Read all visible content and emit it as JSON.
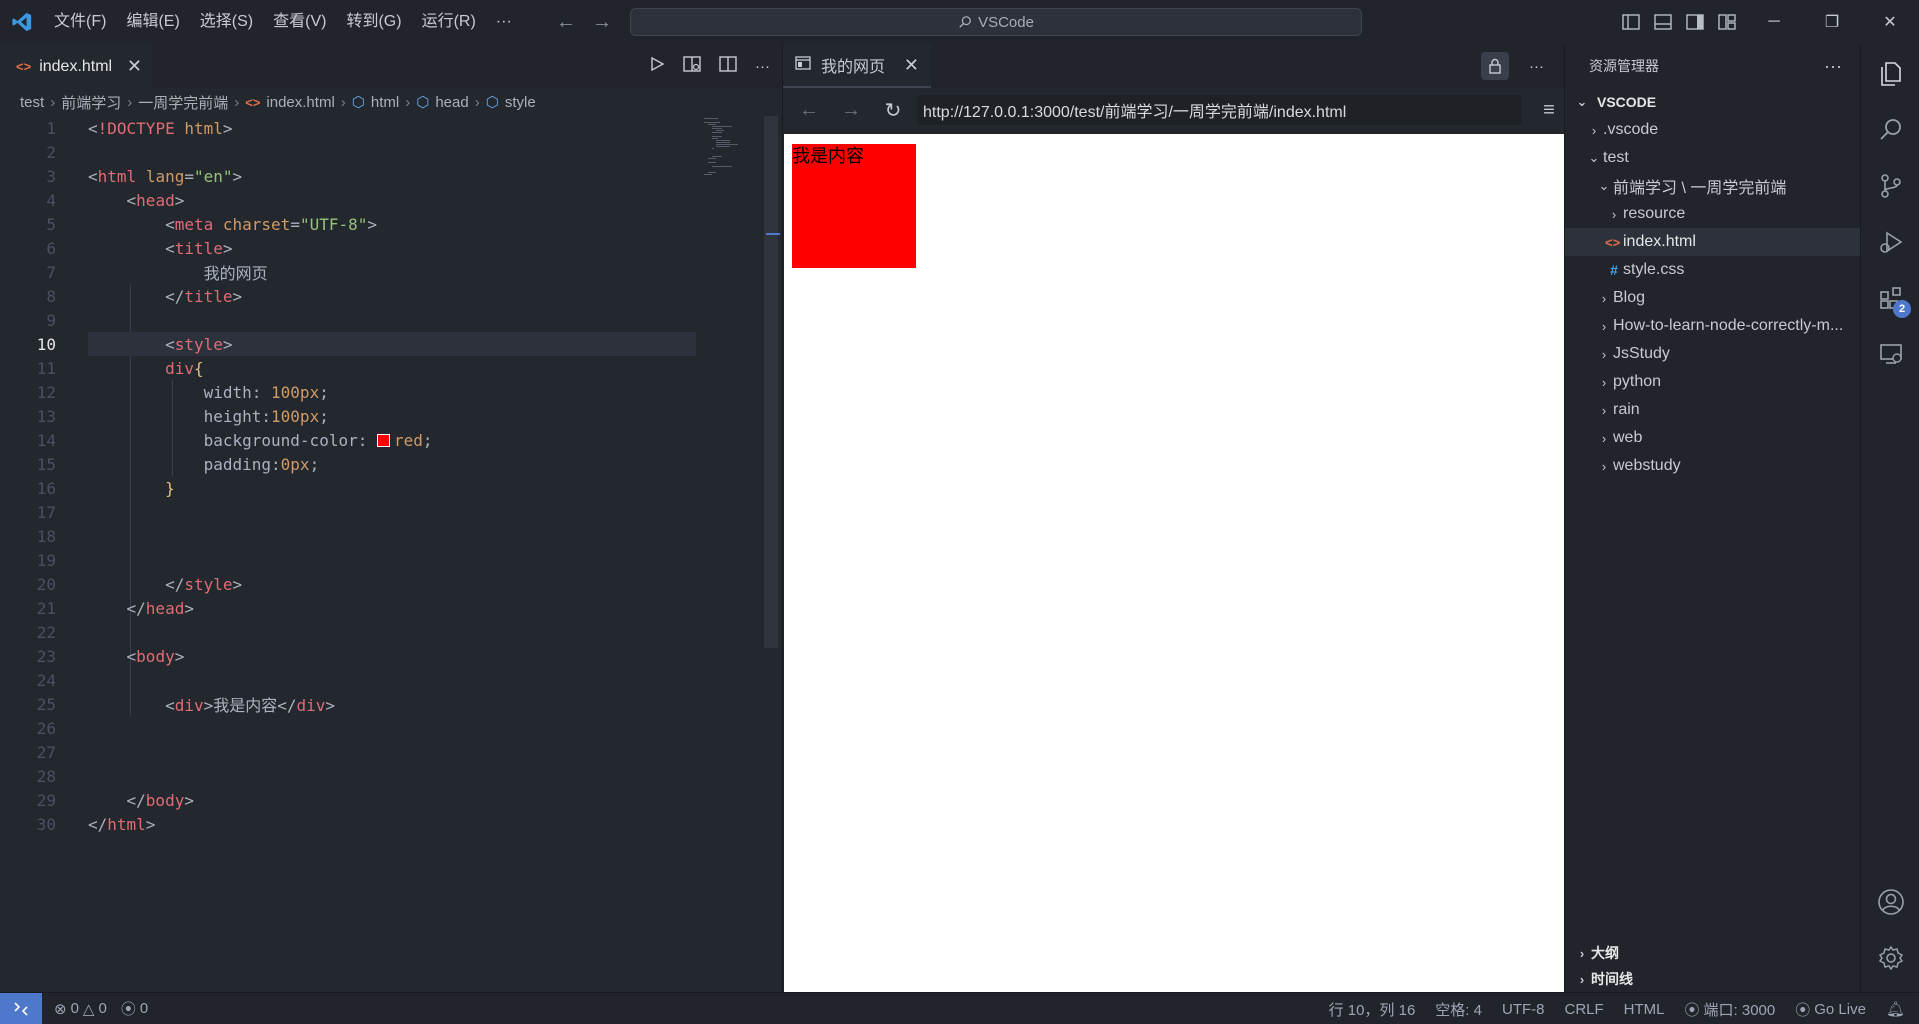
{
  "titlebar": {
    "menu": [
      "文件(F)",
      "编辑(E)",
      "选择(S)",
      "查看(V)",
      "转到(G)",
      "运行(R)",
      "···"
    ],
    "search_text": "VSCode"
  },
  "editor": {
    "tab_label": "index.html",
    "breadcrumbs": [
      "test",
      "前端学习",
      "一周学完前端",
      "index.html",
      "html",
      "head",
      "style"
    ],
    "current_line": 10
  },
  "preview": {
    "tab_label": "我的网页",
    "url": "http://127.0.0.1:3000/test/前端学习/一周学完前端/index.html",
    "page_div_text": "我是内容",
    "div_background": "#ff0000"
  },
  "explorer": {
    "header": "资源管理器",
    "root": "VSCODE",
    "tree": [
      {
        "label": ".vscode",
        "type": "folder",
        "expanded": false
      },
      {
        "label": "test",
        "type": "folder",
        "expanded": true
      },
      {
        "label": "前端学习 \\ 一周学完前端",
        "type": "folder",
        "expanded": true
      },
      {
        "label": "resource",
        "type": "folder",
        "expanded": false
      },
      {
        "label": "index.html",
        "type": "html",
        "selected": true
      },
      {
        "label": "style.css",
        "type": "css"
      },
      {
        "label": "Blog",
        "type": "folder",
        "expanded": false
      },
      {
        "label": "How-to-learn-node-correctly-m...",
        "type": "folder",
        "expanded": false
      },
      {
        "label": "JsStudy",
        "type": "folder",
        "expanded": false
      },
      {
        "label": "python",
        "type": "folder",
        "expanded": false
      },
      {
        "label": "rain",
        "type": "folder",
        "expanded": false
      },
      {
        "label": "web",
        "type": "folder",
        "expanded": false
      },
      {
        "label": "webstudy",
        "type": "folder",
        "expanded": false
      }
    ],
    "bottom_sections": [
      "大纲",
      "时间线"
    ]
  },
  "activity": {
    "extensions_badge": "2"
  },
  "statusbar": {
    "errors": "0",
    "warnings": "0",
    "ports": "0",
    "cursor": "行 10，列 16",
    "spaces": "空格: 4",
    "encoding": "UTF-8",
    "eol": "CRLF",
    "language": "HTML",
    "port": "端口: 3000",
    "golive": "Go Live"
  },
  "colors": {
    "accent": "#4d78cc",
    "tag": "#e06c75",
    "attr": "#d19a66",
    "string": "#98c379"
  }
}
